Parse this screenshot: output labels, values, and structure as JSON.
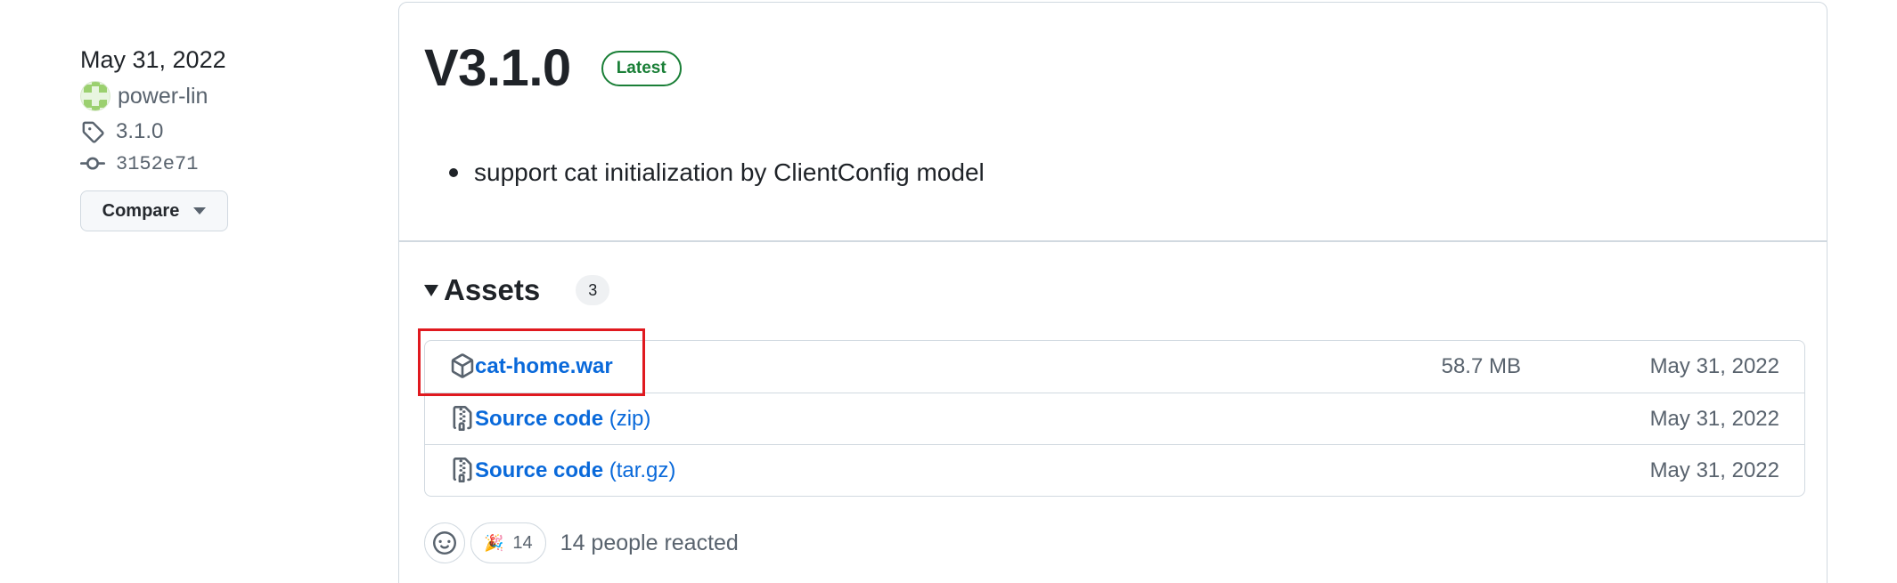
{
  "meta": {
    "date": "May 31, 2022",
    "author": "power-lin",
    "tag": "3.1.0",
    "commit": "3152e71",
    "compare_label": "Compare"
  },
  "release": {
    "title": "V3.1.0",
    "badge": "Latest",
    "notes": [
      "support cat initialization by ClientConfig model"
    ]
  },
  "assets": {
    "title": "Assets",
    "count": "3",
    "items": [
      {
        "name": "cat-home.war",
        "suffix": "",
        "size": "58.7 MB",
        "date": "May 31, 2022",
        "icon": "package-icon"
      },
      {
        "name": "Source code",
        "suffix": " (zip)",
        "size": "",
        "date": "May 31, 2022",
        "icon": "file-zip-icon"
      },
      {
        "name": "Source code",
        "suffix": " (tar.gz)",
        "size": "",
        "date": "May 31, 2022",
        "icon": "file-zip-icon"
      }
    ]
  },
  "reactions": {
    "emoji": "🎉",
    "count": "14",
    "summary": "14 people reacted"
  },
  "colors": {
    "link": "#0969da",
    "latest_green": "#1a7f37",
    "highlight_red": "#e0191f",
    "muted": "#59636e"
  }
}
